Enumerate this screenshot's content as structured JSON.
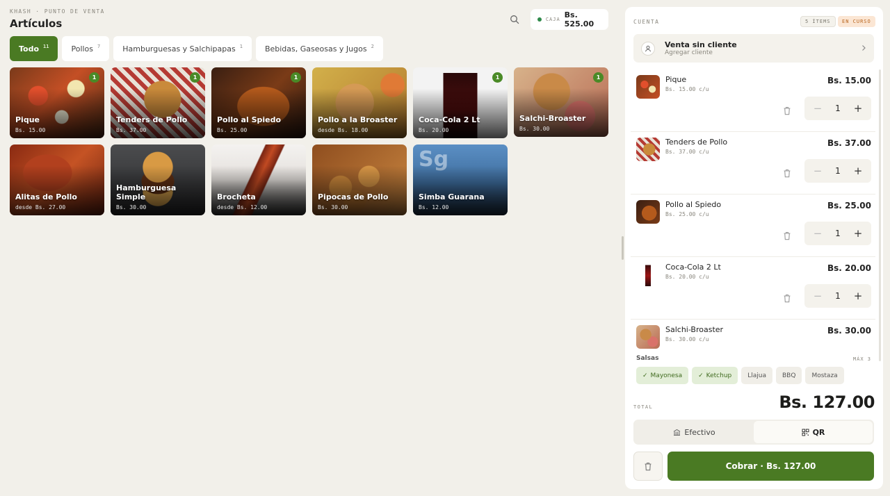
{
  "app": {
    "brand": "KHASH · PUNTO DE VENTA",
    "title": "Artículos",
    "caja_label": "CAJA",
    "caja_amount": "Bs. 525.00",
    "status_color": "#2f8a4a"
  },
  "tabs": [
    {
      "label": "Todo",
      "count": "11",
      "active": true
    },
    {
      "label": "Pollos",
      "count": "7"
    },
    {
      "label": "Hamburguesas y Salchipapas",
      "count": "1"
    },
    {
      "label": "Bebidas, Gaseosas y Jugos",
      "count": "2"
    }
  ],
  "products": [
    {
      "name": "Pique",
      "price": "Bs. 15.00",
      "badge": "1"
    },
    {
      "name": "Tenders de Pollo",
      "price": "Bs. 37.00",
      "badge": "1"
    },
    {
      "name": "Pollo al Spiedo",
      "price": "Bs. 25.00",
      "badge": "1"
    },
    {
      "name": "Pollo a la Broaster",
      "price": "desde Bs. 18.00"
    },
    {
      "name": "Coca-Cola 2 Lt",
      "price": "Bs. 20.00",
      "badge": "1"
    },
    {
      "name": "Salchi-Broaster",
      "price": "Bs. 30.00",
      "badge": "1"
    },
    {
      "name": "Alitas de Pollo",
      "price": "desde Bs. 27.00"
    },
    {
      "name": "Hamburguesa Simple",
      "price": "Bs. 30.00"
    },
    {
      "name": "Brocheta",
      "price": "desde Bs. 12.00"
    },
    {
      "name": "Pipocas de Pollo",
      "price": "Bs. 30.00"
    },
    {
      "name": "Simba Guarana",
      "price": "Bs. 12.00",
      "initials": "Sg"
    }
  ],
  "cart": {
    "heading": "CUENTA",
    "items_pill": "5 ÍTEMS",
    "status_pill": "EN CURSO",
    "customer_title": "Venta sin cliente",
    "customer_sub": "Agregar cliente",
    "lines": [
      {
        "name": "Pique",
        "unit": "Bs. 15.00 c/u",
        "total": "Bs. 15.00",
        "qty": "1"
      },
      {
        "name": "Tenders de Pollo",
        "unit": "Bs. 37.00 c/u",
        "total": "Bs. 37.00",
        "qty": "1"
      },
      {
        "name": "Pollo al Spiedo",
        "unit": "Bs. 25.00 c/u",
        "total": "Bs. 25.00",
        "qty": "1"
      },
      {
        "name": "Coca-Cola 2 Lt",
        "unit": "Bs. 20.00 c/u",
        "total": "Bs. 20.00",
        "qty": "1"
      },
      {
        "name": "Salchi-Broaster",
        "unit": "Bs. 30.00 c/u",
        "total": "Bs. 30.00"
      }
    ],
    "salsas_label": "Salsas",
    "salsas_max": "MÁX 3",
    "salsas": [
      {
        "label": "Mayonesa",
        "selected": true
      },
      {
        "label": "Ketchup",
        "selected": true
      },
      {
        "label": "Llajua"
      },
      {
        "label": "BBQ"
      },
      {
        "label": "Mostaza"
      }
    ],
    "total_label": "TOTAL",
    "total": "Bs. 127.00",
    "pay_cash": "Efectivo",
    "pay_qr": "QR",
    "charge_button": "Cobrar · Bs. 127.00"
  },
  "colors": {
    "accent": "#4a7a23",
    "background": "#f2f0ea",
    "status_pill_bg": "#fbe6d4",
    "status_pill_text": "#b8641d"
  }
}
